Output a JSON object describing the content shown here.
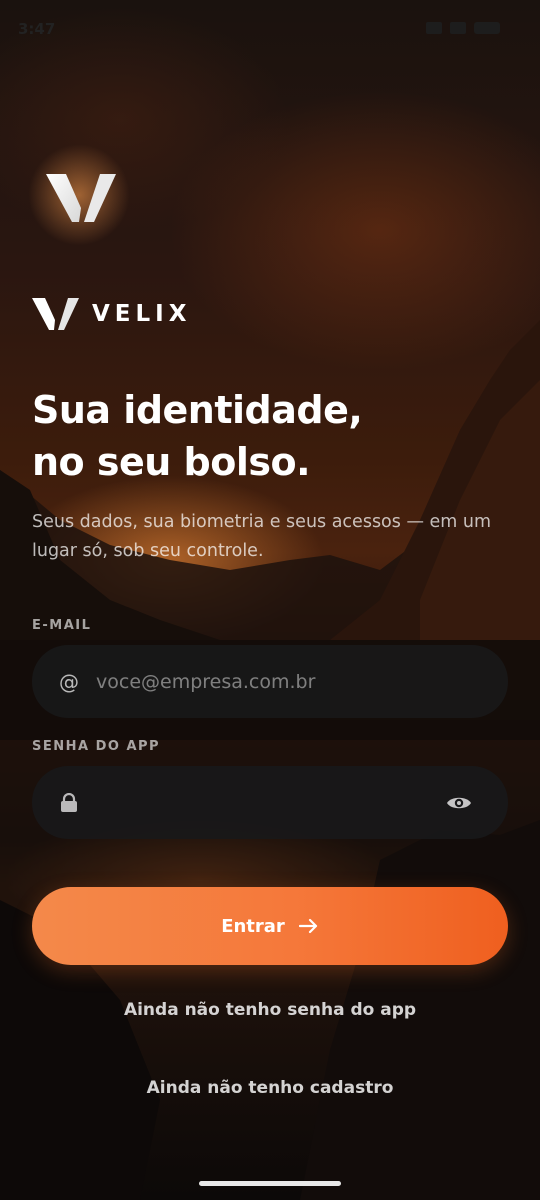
{
  "status_bar": {
    "time": "3:47"
  },
  "brand": {
    "name": "VELIX"
  },
  "hero": {
    "headline_line1": "Sua identidade,",
    "headline_line2": "no seu bolso.",
    "subtitle": "Seus dados, sua biometria e seus acessos — em um lugar só, sob seu controle."
  },
  "form": {
    "email": {
      "label": "E-MAIL",
      "placeholder": "voce@empresa.com.br",
      "icon": "at-icon"
    },
    "password": {
      "label": "SENHA DO APP",
      "placeholder": "",
      "icon": "lock-icon",
      "toggle_icon": "eye-icon"
    },
    "submit_label": "Entrar"
  },
  "links": {
    "no_password": "Ainda não tenho senha do app",
    "no_account": "Ainda não tenho cadastro"
  },
  "colors": {
    "accent_start": "#f4894a",
    "accent_end": "#ef5f1f",
    "field_bg": "#18181a"
  }
}
